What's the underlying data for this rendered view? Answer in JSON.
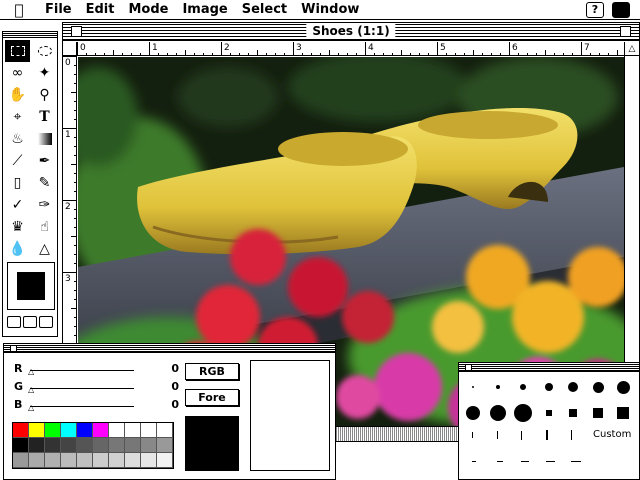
{
  "menubar": {
    "apple": "",
    "items": [
      "File",
      "Edit",
      "Mode",
      "Image",
      "Select",
      "Window"
    ],
    "help_glyph": "?"
  },
  "document": {
    "title": "Shoes (1:1)",
    "ruler_top": [
      "0",
      "1",
      "2",
      "3",
      "4",
      "5",
      "6",
      "7"
    ],
    "ruler_left": [
      "0",
      "1",
      "2",
      "3"
    ]
  },
  "tools": [
    "marquee-rect",
    "marquee-ellipse",
    "lasso",
    "magic-wand",
    "hand",
    "zoom",
    "crop",
    "type",
    "bucket",
    "gradient",
    "line",
    "eyedropper",
    "eraser",
    "pencil",
    "airbrush",
    "brush",
    "rubber-stamp",
    "smudge",
    "blur",
    "sharpen"
  ],
  "colors": {
    "r_label": "R",
    "g_label": "G",
    "b_label": "B",
    "r_value": "0",
    "g_value": "0",
    "b_value": "0",
    "mode_button": "RGB",
    "fore_button": "Fore",
    "swatches_row1": [
      "#ff0000",
      "#ffff00",
      "#00ff00",
      "#00ffff",
      "#0000ff",
      "#ff00ff",
      "#ffffff",
      "#ffffff",
      "#ffffff",
      "#ffffff"
    ],
    "swatches_row2": [
      "#000000",
      "#222222",
      "#333333",
      "#444444",
      "#555555",
      "#666666",
      "#777777",
      "#777777",
      "#888888",
      "#999999"
    ],
    "swatches_row3": [
      "#999999",
      "#aaaaaa",
      "#b0b0b0",
      "#bbbbbb",
      "#c0c0c0",
      "#cccccc",
      "#d0d0d0",
      "#dddddd",
      "#e6e6e6",
      "#f2f2f2"
    ]
  },
  "brushes": {
    "custom_label": "Custom"
  }
}
